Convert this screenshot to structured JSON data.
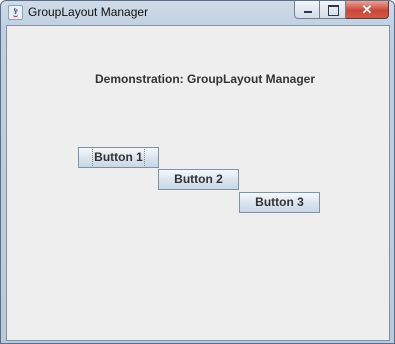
{
  "window": {
    "title": "GroupLayout Manager",
    "controls": {
      "minimize": "minimize",
      "maximize": "maximize",
      "close": "✕"
    }
  },
  "content": {
    "heading": "Demonstration: GroupLayout Manager",
    "buttons": [
      {
        "label": "Button 1",
        "focused": true
      },
      {
        "label": "Button 2",
        "focused": false
      },
      {
        "label": "Button 3",
        "focused": false
      }
    ]
  },
  "colors": {
    "panel_background": "#eeeeee",
    "button_border": "#7d93ad",
    "close_button": "#c9463a"
  }
}
